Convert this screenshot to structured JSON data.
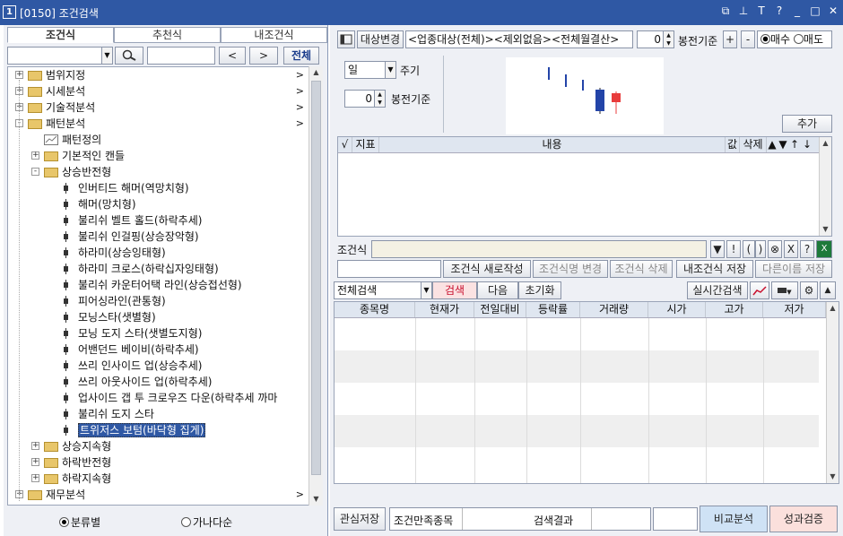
{
  "window": {
    "num": "1",
    "title": "[0150] 조건검색"
  },
  "titlebar_icons": [
    "restore-small-icon",
    "pin-icon",
    "font-icon",
    "help-icon",
    "minimize-icon",
    "maximize-icon",
    "close-icon"
  ],
  "left": {
    "tabs": [
      "조건식",
      "추천식",
      "내조건식"
    ],
    "search": {
      "prev": "<",
      "next": ">",
      "all": "전체"
    },
    "tree": [
      {
        "label": "범위지정",
        "level": 0,
        "type": "folder",
        "exp": "+",
        "chev": ">"
      },
      {
        "label": "시세분석",
        "level": 0,
        "type": "folder",
        "exp": "+",
        "chev": ">"
      },
      {
        "label": "기술적분석",
        "level": 0,
        "type": "folder",
        "exp": "+",
        "chev": ">"
      },
      {
        "label": "패턴분석",
        "level": 0,
        "type": "folder",
        "exp": "-",
        "chev": ">"
      },
      {
        "label": "패턴정의",
        "level": 1,
        "type": "chart"
      },
      {
        "label": "기본적인 캔들",
        "level": 1,
        "type": "folder",
        "exp": "+"
      },
      {
        "label": "상승반전형",
        "level": 1,
        "type": "folder",
        "exp": "-"
      },
      {
        "label": "인버티드 해머(역망치형)",
        "level": 2,
        "type": "candle"
      },
      {
        "label": "해머(망치형)",
        "level": 2,
        "type": "candle"
      },
      {
        "label": "불리쉬 벨트 홀드(하락추세)",
        "level": 2,
        "type": "candle"
      },
      {
        "label": "불리쉬 인걸핑(상승장악형)",
        "level": 2,
        "type": "candle"
      },
      {
        "label": "하라미(상승잉태형)",
        "level": 2,
        "type": "candle"
      },
      {
        "label": "하라미 크로스(하락십자잉태형)",
        "level": 2,
        "type": "candle"
      },
      {
        "label": "불리쉬 카운터어택 라인(상승접선형)",
        "level": 2,
        "type": "candle"
      },
      {
        "label": "피어싱라인(관통형)",
        "level": 2,
        "type": "candle"
      },
      {
        "label": "모닝스타(샛별형)",
        "level": 2,
        "type": "candle"
      },
      {
        "label": "모닝 도지 스타(샛별도지형)",
        "level": 2,
        "type": "candle"
      },
      {
        "label": "어밴던드 베이비(하락추세)",
        "level": 2,
        "type": "candle"
      },
      {
        "label": "쓰리 인사이드 업(상승추세)",
        "level": 2,
        "type": "candle"
      },
      {
        "label": "쓰리 아웃사이드 업(하락추세)",
        "level": 2,
        "type": "candle"
      },
      {
        "label": "업사이드 갭 투 크로우즈 다운(하락추세 까마",
        "level": 2,
        "type": "candle"
      },
      {
        "label": "불리쉬 도지 스타",
        "level": 2,
        "type": "candle"
      },
      {
        "label": "트위저스 보텀(바닥형 집게)",
        "level": 2,
        "type": "candle",
        "selected": true
      },
      {
        "label": "상승지속형",
        "level": 1,
        "type": "folder",
        "exp": "+"
      },
      {
        "label": "하락반전형",
        "level": 1,
        "type": "folder",
        "exp": "+"
      },
      {
        "label": "하락지속형",
        "level": 1,
        "type": "folder",
        "exp": "+"
      },
      {
        "label": "재무분석",
        "level": 0,
        "type": "folder",
        "exp": "+",
        "chev": ">"
      }
    ],
    "radios": [
      {
        "label": "분류별",
        "checked": true
      },
      {
        "label": "가나다순",
        "checked": false
      }
    ]
  },
  "right": {
    "toolbar": {
      "target_change": "대상변경",
      "target_text": "<업종대상(전체)><제외없음><전체월결산>",
      "bong_value": "0",
      "bong_label": "봉전기준",
      "plus": "+",
      "minus": "-",
      "buy": "매수",
      "sell": "매도"
    },
    "pattern": {
      "period_value": "일",
      "period_label": "주기",
      "bong_value": "0",
      "bong_label": "봉전기준",
      "add_button": "추가"
    },
    "cond_table_headers": [
      "√",
      "지표",
      "내용",
      "값",
      "삭제",
      "▲",
      "▼",
      "↑",
      "↓"
    ],
    "formula_label": "조건식",
    "formula_buttons": [
      "▼",
      "!",
      "(",
      ")",
      "⊗",
      "X",
      "?"
    ],
    "actions": [
      "조건식 새로작성",
      "조건식명 변경",
      "조건식 삭제",
      "내조건식 저장",
      "다른이름 저장"
    ],
    "search_row": {
      "selected": "전체검색",
      "search": "검색",
      "next": "다음",
      "reset": "초기화",
      "realtime": "실시간검색"
    },
    "result_headers": [
      "종목명",
      "현재가",
      "전일대비",
      "등락률",
      "거래량",
      "시가",
      "고가",
      "저가"
    ],
    "bottom": {
      "save_interest": "관심저장",
      "satisfy_label": "조건만족종목",
      "result_label": "검색결과",
      "compare": "비교분석",
      "verify": "성과검증"
    }
  }
}
